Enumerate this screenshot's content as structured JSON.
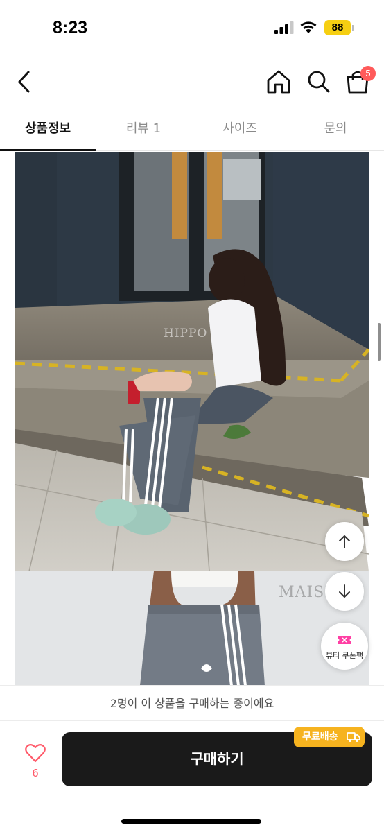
{
  "status": {
    "time": "8:23",
    "battery": "88"
  },
  "header": {
    "cart_count": "5"
  },
  "tabs": [
    {
      "label": "상품정보",
      "active": true
    },
    {
      "label": "리뷰 1",
      "active": false
    },
    {
      "label": "사이즈",
      "active": false
    },
    {
      "label": "문의",
      "active": false
    }
  ],
  "content": {
    "watermark_1": "HIPPO",
    "watermark_2": "MAISO"
  },
  "floating": {
    "coupon_label": "뷰티 쿠폰팩"
  },
  "notice": {
    "text": "2명이 이 상품을 구매하는 중이에요"
  },
  "bottom": {
    "like_count": "6",
    "buy_label": "구매하기",
    "shipping_badge": "무료배송"
  },
  "colors": {
    "accent": "#f6b31f",
    "badge": "#ff5a5a",
    "buy_button": "#1a1a1a",
    "like": "#ff5a6a"
  },
  "icons": [
    "back-arrow-icon",
    "home-icon",
    "search-icon",
    "shopping-bag-icon",
    "arrow-up-icon",
    "arrow-down-icon",
    "coupon-icon",
    "heart-icon",
    "truck-icon"
  ]
}
